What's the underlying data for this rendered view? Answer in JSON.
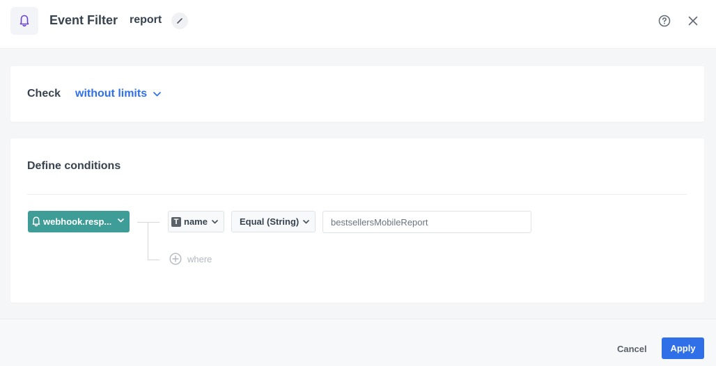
{
  "header": {
    "icon": "bell-icon",
    "title": "Event Filter",
    "report_name": "report",
    "edit_icon": "pencil-icon",
    "help_icon": "help-circle-icon",
    "close_icon": "close-icon"
  },
  "check": {
    "label": "Check",
    "dropdown_value": "without limits"
  },
  "conditions": {
    "title": "Define conditions",
    "event": {
      "icon": "bell-icon",
      "label": "webhook.resp..."
    },
    "parameter": {
      "type_icon": "T",
      "label": "name"
    },
    "operator": {
      "label": "Equal (String)"
    },
    "value": "bestsellersMobileReport",
    "where_label": "where"
  },
  "footer": {
    "cancel_label": "Cancel",
    "apply_label": "Apply"
  },
  "colors": {
    "accent": "#2f6fe8",
    "event_pill": "#3f9d98",
    "icon_purple": "#6a3fd1"
  }
}
